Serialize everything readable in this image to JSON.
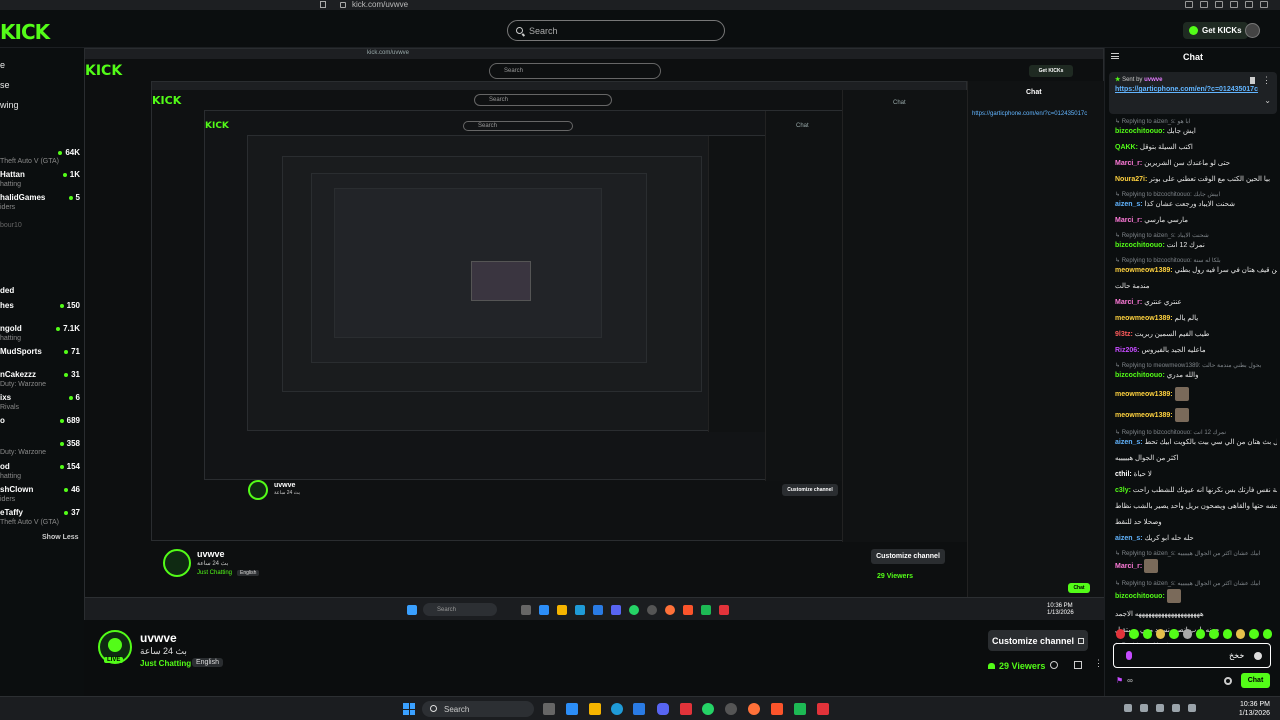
{
  "browser": {
    "url": "kick.com/uvwve"
  },
  "header": {
    "logo": "KICK",
    "search_placeholder": "Search",
    "get_kicks": "Get KICKs"
  },
  "sidebar": {
    "nav": [
      "e",
      "se",
      "wing"
    ],
    "channels": [
      {
        "name": "Hattan",
        "sub": "Theft Auto V (GTA)",
        "viewers": "64K"
      },
      {
        "name": "Hattan",
        "sub": "hatting",
        "viewers": "1K"
      },
      {
        "name": "halidGames",
        "sub": "iders",
        "viewers": "5"
      },
      {
        "name": "bour10",
        "sub": "",
        "viewers": ""
      },
      {
        "name": "ded",
        "sub": "",
        "viewers": ""
      },
      {
        "name": "hes",
        "sub": "",
        "viewers": "150"
      },
      {
        "name": "ngold",
        "sub": "hatting",
        "viewers": "7.1K"
      },
      {
        "name": "MudSports",
        "sub": "",
        "viewers": "71"
      },
      {
        "name": "nCakezzz",
        "sub": "Duty: Warzone",
        "viewers": "31"
      },
      {
        "name": "ixs",
        "sub": "Rivals",
        "viewers": "6"
      },
      {
        "name": "o",
        "sub": "",
        "viewers": "689"
      },
      {
        "name": "",
        "sub": "Duty: Warzone",
        "viewers": "358"
      },
      {
        "name": "od",
        "sub": "hatting",
        "viewers": "154"
      },
      {
        "name": "shClown",
        "sub": "iders",
        "viewers": "46"
      },
      {
        "name": "eTaffy",
        "sub": "Theft Auto V (GTA)",
        "viewers": "37"
      }
    ],
    "show_less": "Show Less"
  },
  "stream": {
    "name": "uvwve",
    "title": "بث 24 ساعة",
    "category": "Just Chatting",
    "language": "English",
    "live": "LIVE",
    "customize": "Customize channel",
    "viewers": "29 Viewers"
  },
  "chat": {
    "title": "Chat",
    "pinned_sent_by": "Sent by",
    "pinned_user": "uvwve",
    "pinned_link": "https://garticphone.com/en/?c=012435017c",
    "input_text": "خخخ",
    "send": "Chat",
    "messages": [
      {
        "reply": "Replying to aizen_s: ابا هو",
        "user": "bizcochitoouo:",
        "color": "#53fc18",
        "text": "ايش جابك"
      },
      {
        "reply": "",
        "user": "QAKK:",
        "color": "#53fc18",
        "text": "اكتب السيلة بتوقل"
      },
      {
        "reply": "",
        "user": "Marci_r:",
        "color": "#ff7ad9",
        "text": "حتى لو ماعندك سن الشريرين"
      },
      {
        "reply": "",
        "user": "Noura27i:",
        "color": "#ffd23f",
        "text": "بيا الحين الكتب مع الوقت تعطني على بوتر"
      },
      {
        "reply": "Replying to bizcochitoouo: ابيش جابك",
        "user": "aizen_s:",
        "color": "#62b5ff",
        "text": "شحنت الايباد ورجعت عشان كذا"
      },
      {
        "reply": "",
        "user": "Marci_r:",
        "color": "#ff7ad9",
        "text": "مارسي مارسي"
      },
      {
        "reply": "Replying to aizen_s: شحنت الايباد",
        "user": "bizcochitoouo:",
        "color": "#53fc18",
        "text": "نمرك 12 انت"
      },
      {
        "reply": "Replying to bizcochitoouo: بلكا له سنة",
        "user": "meowmeow1389:",
        "color": "#ffd23f",
        "text": "وين قيف هتان في سرا فيه رول بطني"
      },
      {
        "reply": "",
        "user": "",
        "color": "#e8e8e8",
        "text": "مندمة حالت"
      },
      {
        "reply": "",
        "user": "Marci_r:",
        "color": "#ff7ad9",
        "text": "عنتري عنتري"
      },
      {
        "reply": "",
        "user": "meowmeow1389:",
        "color": "#ffd23f",
        "text": "يالم يالم"
      },
      {
        "reply": "",
        "user": "9l3tz:",
        "color": "#ff5b5b",
        "text": "طيب الفيم السمين ربريت"
      },
      {
        "reply": "",
        "user": "Riz206:",
        "color": "#c54bff",
        "text": "ماعليه الجيد بالفيروس"
      },
      {
        "reply": "Replying to meowmeow1389: بحول بطني مندمة حالت",
        "user": "bizcochitoouo:",
        "color": "#53fc18",
        "text": "والله مدري"
      },
      {
        "reply": "",
        "user": "meowmeow1389:",
        "color": "#ffd23f",
        "text": ""
      },
      {
        "reply": "",
        "user": "meowmeow1389:",
        "color": "#ffd23f",
        "text": ""
      },
      {
        "reply": "Replying to bizcochitoouo: نمرك 12 انت",
        "user": "aizen_s:",
        "color": "#62b5ff",
        "text": "داخل بث هتان من الي سي بيت بالكويت ابيك تحط"
      },
      {
        "reply": "",
        "user": "",
        "color": "#e8e8e8",
        "text": "اكثر من الجوال هيييييه"
      },
      {
        "reply": "",
        "user": "cthil:",
        "color": "#ffffff",
        "text": "لا حياة"
      },
      {
        "reply": "",
        "user": "c3ly:",
        "color": "#53fc18",
        "text": "فيه شهة نفس فارتك بس نكرنها انه عيونك للشطب راحت"
      },
      {
        "reply": "",
        "user": "",
        "color": "#e8e8e8",
        "text": "عرسو وحشه حتها والقاهى ويضحون بريل واحد يصير بالشب نظاط"
      },
      {
        "reply": "",
        "user": "",
        "color": "#e8e8e8",
        "text": "وصحلا حد للنقط"
      },
      {
        "reply": "",
        "user": "aizen_s:",
        "color": "#62b5ff",
        "text": "حله حله ابو كريك"
      },
      {
        "reply": "Replying to aizen_s: ابيك عشان اكثر من الجوال هيييييه",
        "user": "Marci_r:",
        "color": "#ff7ad9",
        "text": ""
      },
      {
        "reply": "Replying to aizen_s: ابيك عشان اكثر من الجوال هيييييه",
        "user": "bizcochitoouo:",
        "color": "#53fc18",
        "text": ""
      },
      {
        "reply": "",
        "user": "",
        "color": "#e8e8e8",
        "text": "ههههههههههههههههههههه الاجمد"
      },
      {
        "reply": "",
        "user": "",
        "color": "#e8e8e8",
        "text": "جونه بارب انصير نسود معي مستقبل"
      },
      {
        "reply": "Replying to Marci_r:",
        "user": "aizen_s:",
        "color": "#62b5ff",
        "text": "حله حله"
      }
    ]
  },
  "taskbar": {
    "search": "Search",
    "time": "10:36 PM",
    "date": "1/13/2026"
  }
}
